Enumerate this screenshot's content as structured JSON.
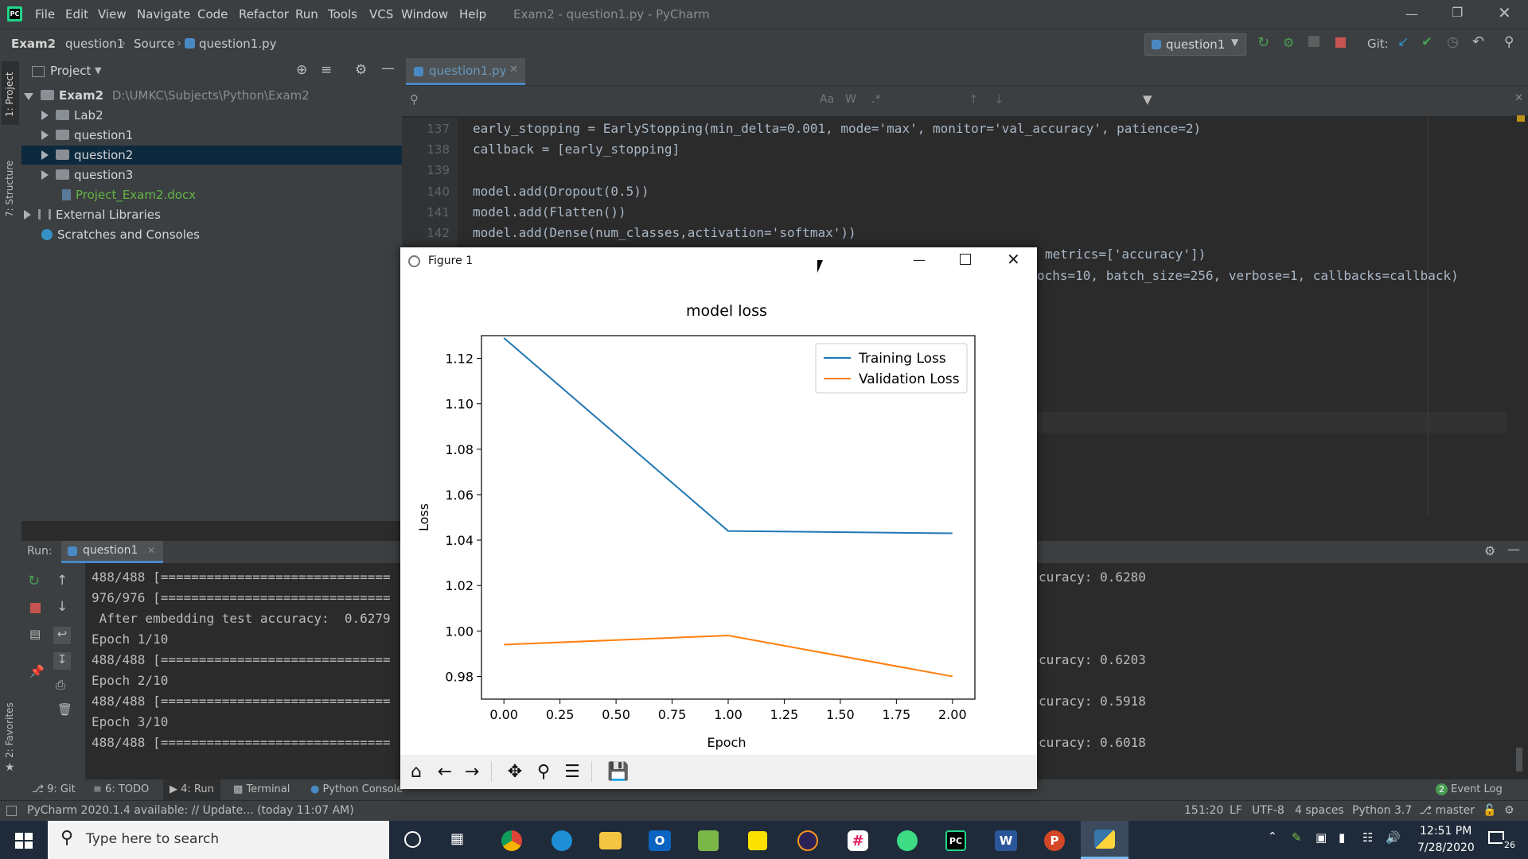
{
  "window": {
    "title": "Exam2 - question1.py - PyCharm",
    "menu": [
      "File",
      "Edit",
      "View",
      "Navigate",
      "Code",
      "Refactor",
      "Run",
      "Tools",
      "VCS",
      "Window",
      "Help"
    ]
  },
  "navbar": {
    "breadcrumbs": [
      "Exam2",
      "question1",
      "Source",
      "question1.py"
    ],
    "run_config": "question1",
    "git_label": "Git:"
  },
  "side_tabs": {
    "project": "1: Project",
    "structure": "7: Structure",
    "favorites": "2: Favorites"
  },
  "project": {
    "header": "Project",
    "root_name": "Exam2",
    "root_path": "D:\\UMKC\\Subjects\\Python\\Exam2",
    "items": [
      {
        "label": "Lab2"
      },
      {
        "label": "question1"
      },
      {
        "label": "question2"
      },
      {
        "label": "question3"
      },
      {
        "label": "Project_Exam2.docx"
      }
    ],
    "external": "External Libraries",
    "scratches": "Scratches and Consoles"
  },
  "editor": {
    "tab": "question1.py",
    "line_numbers": [
      "137",
      "138",
      "139",
      "140",
      "141",
      "142"
    ],
    "code_lines": [
      "early_stopping = EarlyStopping(min_delta=0.001, mode='max', monitor='val_accuracy', patience=2)",
      "callback = [early_stopping]",
      "",
      "model.add(Dropout(0.5))",
      "model.add(Flatten())",
      "model.add(Dense(num_classes,activation='softmax'))"
    ],
    "partial_line_1": "metrics=['accuracy'])",
    "partial_line_2": "ochs=10, batch_size=256, verbose=1, callbacks=callback)"
  },
  "run": {
    "label": "Run:",
    "tab": "question1",
    "output_left": [
      "488/488 [==============================",
      "976/976 [==============================",
      " After embedding test accuracy:  0.6279",
      "Epoch 1/10",
      "488/488 [==============================",
      "Epoch 2/10",
      "488/488 [==============================",
      "Epoch 3/10",
      "488/488 [=============================="
    ],
    "output_right": [
      "curacy: 0.6280",
      "curacy: 0.6203",
      "curacy: 0.5918",
      "curacy: 0.6018"
    ]
  },
  "bottom_tabs": [
    "9: Git",
    "6: TODO",
    "4: Run",
    "Terminal",
    "Python Console"
  ],
  "event_log": "Event Log",
  "event_count": "2",
  "status": {
    "message": "PyCharm 2020.1.4 available: // Update... (today 11:07 AM)",
    "position": "151:20",
    "line_sep": "LF",
    "encoding": "UTF-8",
    "indent": "4 spaces",
    "interpreter": "Python 3.7",
    "branch": "master"
  },
  "figure": {
    "title": "Figure 1"
  },
  "chart_data": {
    "type": "line",
    "title": "model loss",
    "xlabel": "Epoch",
    "ylabel": "Loss",
    "x": [
      0.0,
      1.0,
      2.0
    ],
    "xlim": [
      -0.1,
      2.1
    ],
    "ylim": [
      0.97,
      1.13
    ],
    "xticks": [
      "0.00",
      "0.25",
      "0.50",
      "0.75",
      "1.00",
      "1.25",
      "1.50",
      "1.75",
      "2.00"
    ],
    "yticks": [
      "0.98",
      "1.00",
      "1.02",
      "1.04",
      "1.06",
      "1.08",
      "1.10",
      "1.12"
    ],
    "legend_position": "top-right",
    "series": [
      {
        "name": "Training Loss",
        "color": "#1f77b4",
        "values": [
          1.129,
          1.044,
          1.043
        ]
      },
      {
        "name": "Validation Loss",
        "color": "#ff7f0e",
        "values": [
          0.994,
          0.998,
          0.98
        ]
      }
    ]
  },
  "taskbar": {
    "search_placeholder": "Type here to search",
    "time": "12:51 PM",
    "date": "7/28/2020",
    "notifications": "26"
  }
}
